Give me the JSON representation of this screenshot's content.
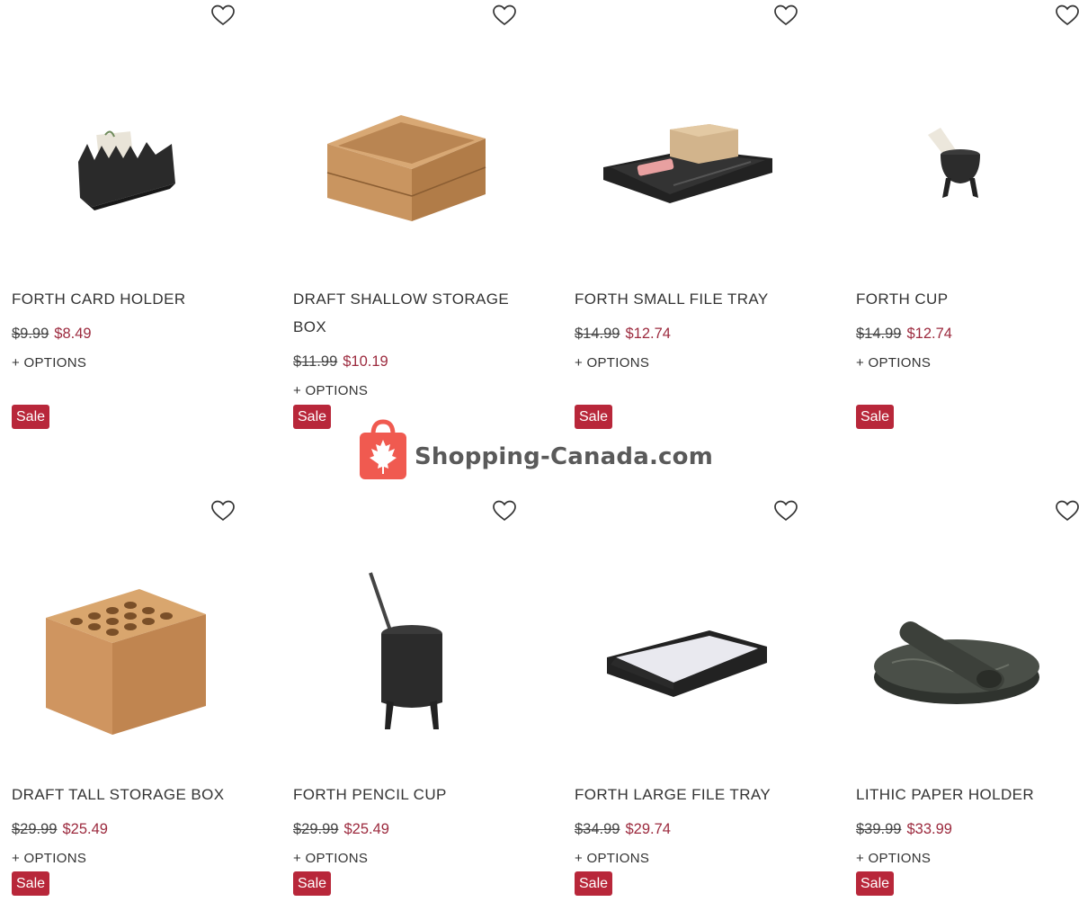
{
  "products": [
    {
      "name": "FORTH CARD HOLDER",
      "old_price": "$9.99",
      "price": "$8.49",
      "options": "+ OPTIONS",
      "badge": "Sale",
      "heart": "heart-outline-icon"
    },
    {
      "name": "DRAFT SHALLOW STORAGE BOX",
      "old_price": "$11.99",
      "price": "$10.19",
      "options": "+ OPTIONS",
      "badge": "Sale",
      "heart": "heart-outline-icon"
    },
    {
      "name": "FORTH SMALL FILE TRAY",
      "old_price": "$14.99",
      "price": "$12.74",
      "options": "+ OPTIONS",
      "badge": "Sale",
      "heart": "heart-outline-icon"
    },
    {
      "name": "FORTH CUP",
      "old_price": "$14.99",
      "price": "$12.74",
      "options": "+ OPTIONS",
      "badge": "Sale",
      "heart": "heart-outline-icon"
    },
    {
      "name": "DRAFT TALL STORAGE BOX",
      "old_price": "$29.99",
      "price": "$25.49",
      "options": "+ OPTIONS",
      "badge": "Sale",
      "heart": "heart-outline-icon"
    },
    {
      "name": "FORTH PENCIL CUP",
      "old_price": "$29.99",
      "price": "$25.49",
      "options": "+ OPTIONS",
      "badge": "Sale",
      "heart": "heart-outline-icon"
    },
    {
      "name": "FORTH LARGE FILE TRAY",
      "old_price": "$34.99",
      "price": "$29.74",
      "options": "+ OPTIONS",
      "badge": "Sale",
      "heart": "heart-outline-icon"
    },
    {
      "name": "LITHIC PAPER HOLDER",
      "old_price": "$39.99",
      "price": "$33.99",
      "options": "+ OPTIONS",
      "badge": "Sale",
      "heart": "heart-outline-icon"
    }
  ],
  "watermark": {
    "text": "Shopping-Canada.com",
    "icon": "maple-leaf-bag-icon"
  },
  "colors": {
    "sale_badge": "#b8273a",
    "sale_price": "#9c2a3e",
    "watermark_red": "#f05a50"
  }
}
